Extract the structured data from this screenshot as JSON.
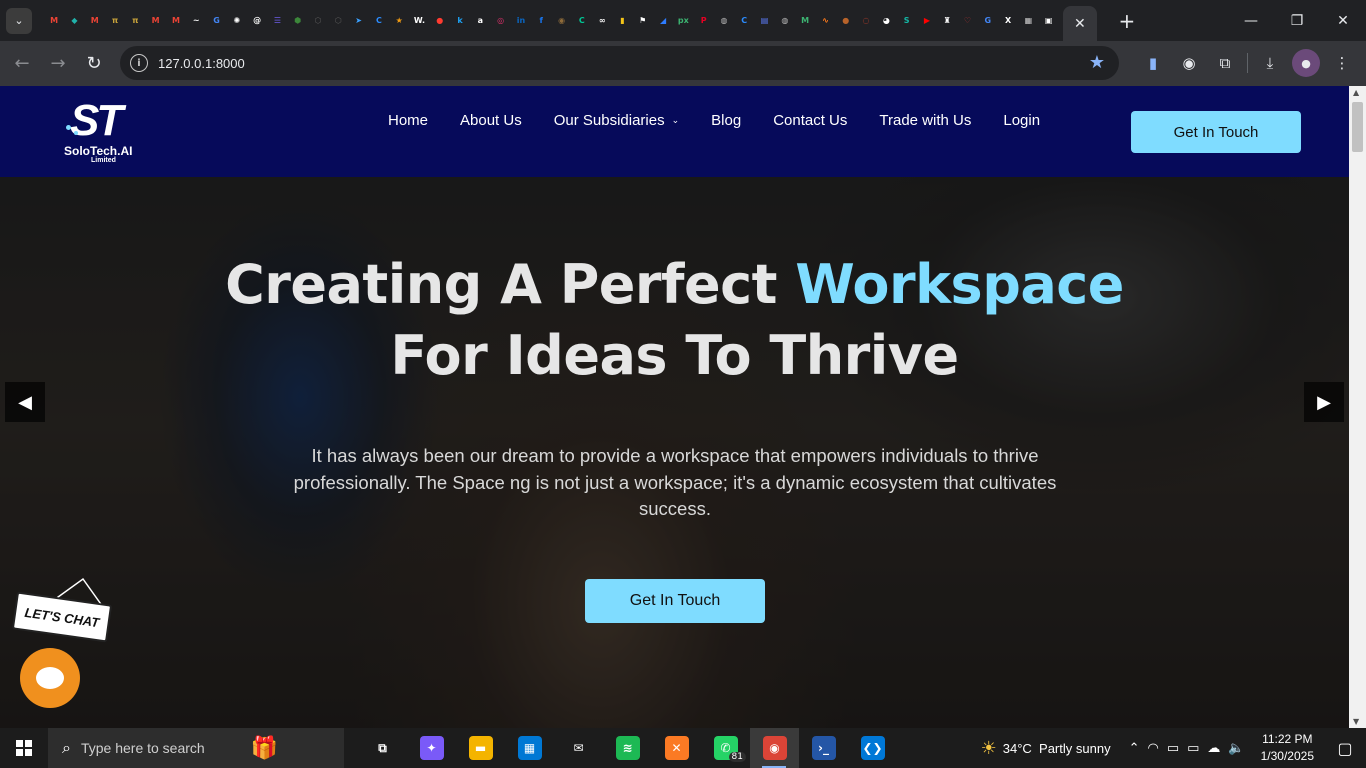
{
  "browser": {
    "url": "127.0.0.1:8000",
    "pinned_tabs": [
      {
        "icon": "gmail-icon",
        "glyph": "M",
        "color": "#ea4335"
      },
      {
        "icon": "diamond-icon",
        "glyph": "◆",
        "color": "#20b2aa"
      },
      {
        "icon": "gmail-icon",
        "glyph": "M",
        "color": "#ea4335"
      },
      {
        "icon": "pi-icon",
        "glyph": "π",
        "color": "#c7a23a"
      },
      {
        "icon": "pi-icon",
        "glyph": "π",
        "color": "#c7a23a"
      },
      {
        "icon": "gmail-icon",
        "glyph": "M",
        "color": "#ea4335"
      },
      {
        "icon": "gmail-icon",
        "glyph": "M",
        "color": "#ea4335"
      },
      {
        "icon": "wave-icon",
        "glyph": "~",
        "color": "#ffffff"
      },
      {
        "icon": "google-icon",
        "glyph": "G",
        "color": "#4285f4"
      },
      {
        "icon": "openai-icon",
        "glyph": "✺",
        "color": "#ffffff"
      },
      {
        "icon": "web-icon",
        "glyph": "@",
        "color": "#ffffff"
      },
      {
        "icon": "list-icon",
        "glyph": "☰",
        "color": "#6c5ce7"
      },
      {
        "icon": "node-icon",
        "glyph": "⬢",
        "color": "#3c873a"
      },
      {
        "icon": "hex-icon",
        "glyph": "⬡",
        "color": "#5a5a5a"
      },
      {
        "icon": "hex-icon",
        "glyph": "⬡",
        "color": "#5a5a5a"
      },
      {
        "icon": "arrow-icon",
        "glyph": "➤",
        "color": "#3aa0ff"
      },
      {
        "icon": "c-icon",
        "glyph": "C",
        "color": "#2b8cff"
      },
      {
        "icon": "star-icon",
        "glyph": "★",
        "color": "#f39c12"
      },
      {
        "icon": "w-icon",
        "glyph": "W.",
        "color": "#ffffff"
      },
      {
        "icon": "record-icon",
        "glyph": "●",
        "color": "#ff3b30"
      },
      {
        "icon": "k-icon",
        "glyph": "k",
        "color": "#1da1f2"
      },
      {
        "icon": "amazon-icon",
        "glyph": "a",
        "color": "#ffffff"
      },
      {
        "icon": "instagram-icon",
        "glyph": "◎",
        "color": "#e1306c"
      },
      {
        "icon": "linkedin-icon",
        "glyph": "in",
        "color": "#0a66c2"
      },
      {
        "icon": "facebook-icon",
        "glyph": "f",
        "color": "#1877f2"
      },
      {
        "icon": "circle-icon",
        "glyph": "◉",
        "color": "#8e6b3a"
      },
      {
        "icon": "c-icon",
        "glyph": "C",
        "color": "#00c896"
      },
      {
        "icon": "link-icon",
        "glyph": "∞",
        "color": "#ffffff"
      },
      {
        "icon": "bookmark-icon",
        "glyph": "▮",
        "color": "#f5c518"
      },
      {
        "icon": "flag-icon",
        "glyph": "⚑",
        "color": "#ffffff"
      },
      {
        "icon": "bluesky-icon",
        "glyph": "◢",
        "color": "#2d7cff"
      },
      {
        "icon": "px-icon",
        "glyph": "px",
        "color": "#3cb371"
      },
      {
        "icon": "pinterest-icon",
        "glyph": "P",
        "color": "#e60023"
      },
      {
        "icon": "globe-icon",
        "glyph": "◍",
        "color": "#bbbbbb"
      },
      {
        "icon": "c-icon",
        "glyph": "C",
        "color": "#2b8cff"
      },
      {
        "icon": "chat-icon",
        "glyph": "▤",
        "color": "#5b7cfa"
      },
      {
        "icon": "globe-icon",
        "glyph": "◍",
        "color": "#bbbbbb"
      },
      {
        "icon": "mail-icon",
        "glyph": "M",
        "color": "#3cb371"
      },
      {
        "icon": "graph-icon",
        "glyph": "∿",
        "color": "#ff7a1a"
      },
      {
        "icon": "cookie-icon",
        "glyph": "●",
        "color": "#b8632a"
      },
      {
        "icon": "loading-icon",
        "glyph": "◌",
        "color": "#e0442a"
      },
      {
        "icon": "panda-icon",
        "glyph": "◕",
        "color": "#ffffff"
      },
      {
        "icon": "s-icon",
        "glyph": "S",
        "color": "#14b8a6"
      },
      {
        "icon": "youtube-icon",
        "glyph": "▶",
        "color": "#ff0000"
      },
      {
        "icon": "figure-icon",
        "glyph": "♜",
        "color": "#ffffff"
      },
      {
        "icon": "heart-icon",
        "glyph": "♡",
        "color": "#aa3333"
      },
      {
        "icon": "g-icon",
        "glyph": "G",
        "color": "#4285f4"
      },
      {
        "icon": "x-icon",
        "glyph": "X",
        "color": "#ffffff"
      },
      {
        "icon": "grid-icon",
        "glyph": "▦",
        "color": "#cccccc"
      },
      {
        "icon": "doc-icon",
        "glyph": "▣",
        "color": "#ffffff"
      }
    ]
  },
  "site": {
    "logo_mark": "ST",
    "logo_name": "SoloTech.AI",
    "logo_sub": "Limited",
    "menu": [
      {
        "label": "Home",
        "dropdown": false
      },
      {
        "label": "About Us",
        "dropdown": false
      },
      {
        "label": "Our Subsidiaries",
        "dropdown": true
      },
      {
        "label": "Blog",
        "dropdown": false
      },
      {
        "label": "Contact Us",
        "dropdown": false
      },
      {
        "label": "Trade with Us",
        "dropdown": false
      },
      {
        "label": "Login",
        "dropdown": false
      }
    ],
    "nav_cta": "Get In Touch",
    "accent_color": "#7fdcff",
    "nav_color": "#060a5a"
  },
  "hero": {
    "title_part1": "Creating A Perfect ",
    "title_accent": "Workspace",
    "title_line2": "For Ideas To Thrive",
    "text": "It has always been our dream to provide a workspace that empowers individuals to thrive professionally. The Space ng is not just a workspace; it's a dynamic ecosystem that cultivates success.",
    "cta": "Get In Touch"
  },
  "chat_widget": {
    "sign": "LET'S CHAT"
  },
  "taskbar": {
    "search_placeholder": "Type here to search",
    "apps": [
      {
        "name": "task-view-icon",
        "glyph": "⧉",
        "bg": "transparent"
      },
      {
        "name": "copilot-icon",
        "glyph": "✦",
        "bg": "#7a5af8"
      },
      {
        "name": "file-explorer-icon",
        "glyph": "▬",
        "bg": "#f4b400"
      },
      {
        "name": "microsoft-store-icon",
        "glyph": "▦",
        "bg": "#0078d4"
      },
      {
        "name": "mail-icon",
        "glyph": "✉",
        "bg": "transparent"
      },
      {
        "name": "spotify-icon",
        "glyph": "≋",
        "bg": "#1db954"
      },
      {
        "name": "xampp-icon",
        "glyph": "✕",
        "bg": "#fb7a24"
      },
      {
        "name": "whatsapp-icon",
        "glyph": "✆",
        "bg": "#25d366",
        "badge": "81"
      },
      {
        "name": "chrome-icon",
        "glyph": "◉",
        "bg": "#db4437",
        "active": true
      },
      {
        "name": "powershell-icon",
        "glyph": "›_",
        "bg": "#2456a6"
      },
      {
        "name": "vscode-icon",
        "glyph": "❮❯",
        "bg": "#0078d7"
      }
    ],
    "weather_temp": "34°C",
    "weather_desc": "Partly sunny",
    "time": "11:22 PM",
    "date": "1/30/2025"
  }
}
